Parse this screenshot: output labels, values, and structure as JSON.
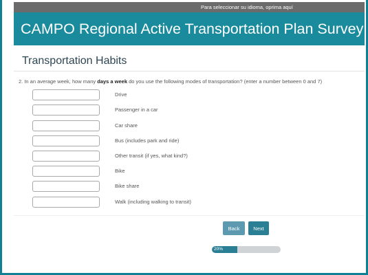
{
  "language_bar": {
    "text": "Para seleccionar su idioma, oprima aquí"
  },
  "survey": {
    "title": "CAMPO Regional Active Transportation Plan Survey"
  },
  "section": {
    "title": "Transportation Habits"
  },
  "question": {
    "prefix": "2. In an average week, how many ",
    "emphasis": "days a week",
    "suffix": " do you use the following modes of transportation? (enter a number between 0 and 7)"
  },
  "modes": [
    {
      "label": "Drive",
      "value": ""
    },
    {
      "label": "Passenger in a car",
      "value": ""
    },
    {
      "label": "Car share",
      "value": ""
    },
    {
      "label": "Bus (includes park and ride)",
      "value": ""
    },
    {
      "label": "Other transit (if yes, what kind?)",
      "value": ""
    },
    {
      "label": "Bike",
      "value": ""
    },
    {
      "label": "Bike share",
      "value": ""
    },
    {
      "label": "Walk (including walking to transit)",
      "value": ""
    }
  ],
  "nav": {
    "back_label": "Back",
    "next_label": "Next"
  },
  "progress": {
    "percent": 20,
    "label": "20%"
  },
  "colors": {
    "brand_teal": "#1a8b9c",
    "button": "#2a7f95",
    "button_back": "#5d9ab0",
    "language_bar": "#6b6b6b"
  }
}
